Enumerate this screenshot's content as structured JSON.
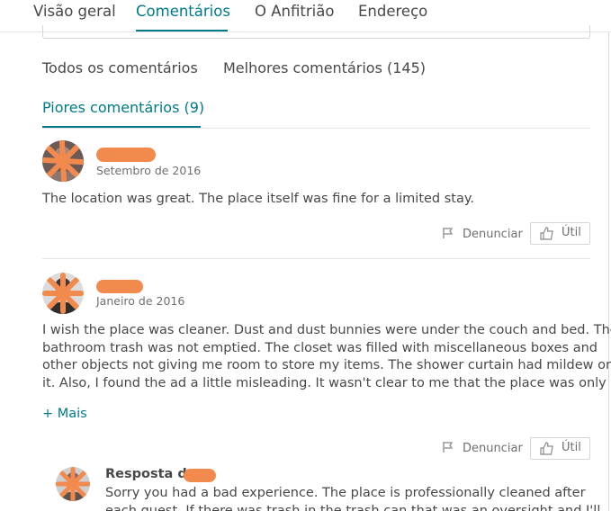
{
  "nav": {
    "tabs": [
      {
        "label": "Visão geral"
      },
      {
        "label": "Comentários"
      },
      {
        "label": "O Anfitrião"
      },
      {
        "label": "Endereço"
      }
    ],
    "active_index": 1
  },
  "filters": {
    "all": "Todos os comentários",
    "best": "Melhores comentários (145)",
    "worst": "Piores comentários (9)"
  },
  "reviews": [
    {
      "date": "Setembro de 2016",
      "text": "The location was great. The place itself was fine for a limited stay.",
      "report_label": "Denunciar",
      "useful_label": "Útil"
    },
    {
      "date": "Janeiro de 2016",
      "text_lines": [
        "I wish the place was cleaner. Dust and dust bunnies were under the couch and bed. The",
        "bathroom trash was not emptied. The closet was filled with miscellaneous boxes and",
        "other objects not giving me room to store my items. The shower curtain had mildew on",
        "it.  Also, I found the ad a little misleading. It wasn't clear to me that the place was only"
      ],
      "more_label": "+ Mais",
      "report_label": "Denunciar",
      "useful_label": "Útil",
      "response": {
        "title": "Resposta de",
        "text_lines": [
          "Sorry you had a bad experience. The place is professionally cleaned after",
          "each guest. If there was trash in the trash can that was an oversight and I'll"
        ]
      }
    }
  ],
  "colors": {
    "accent": "#007a87",
    "text": "#484848",
    "muted": "#6f6f6f",
    "redaction": "#f28a4e"
  }
}
